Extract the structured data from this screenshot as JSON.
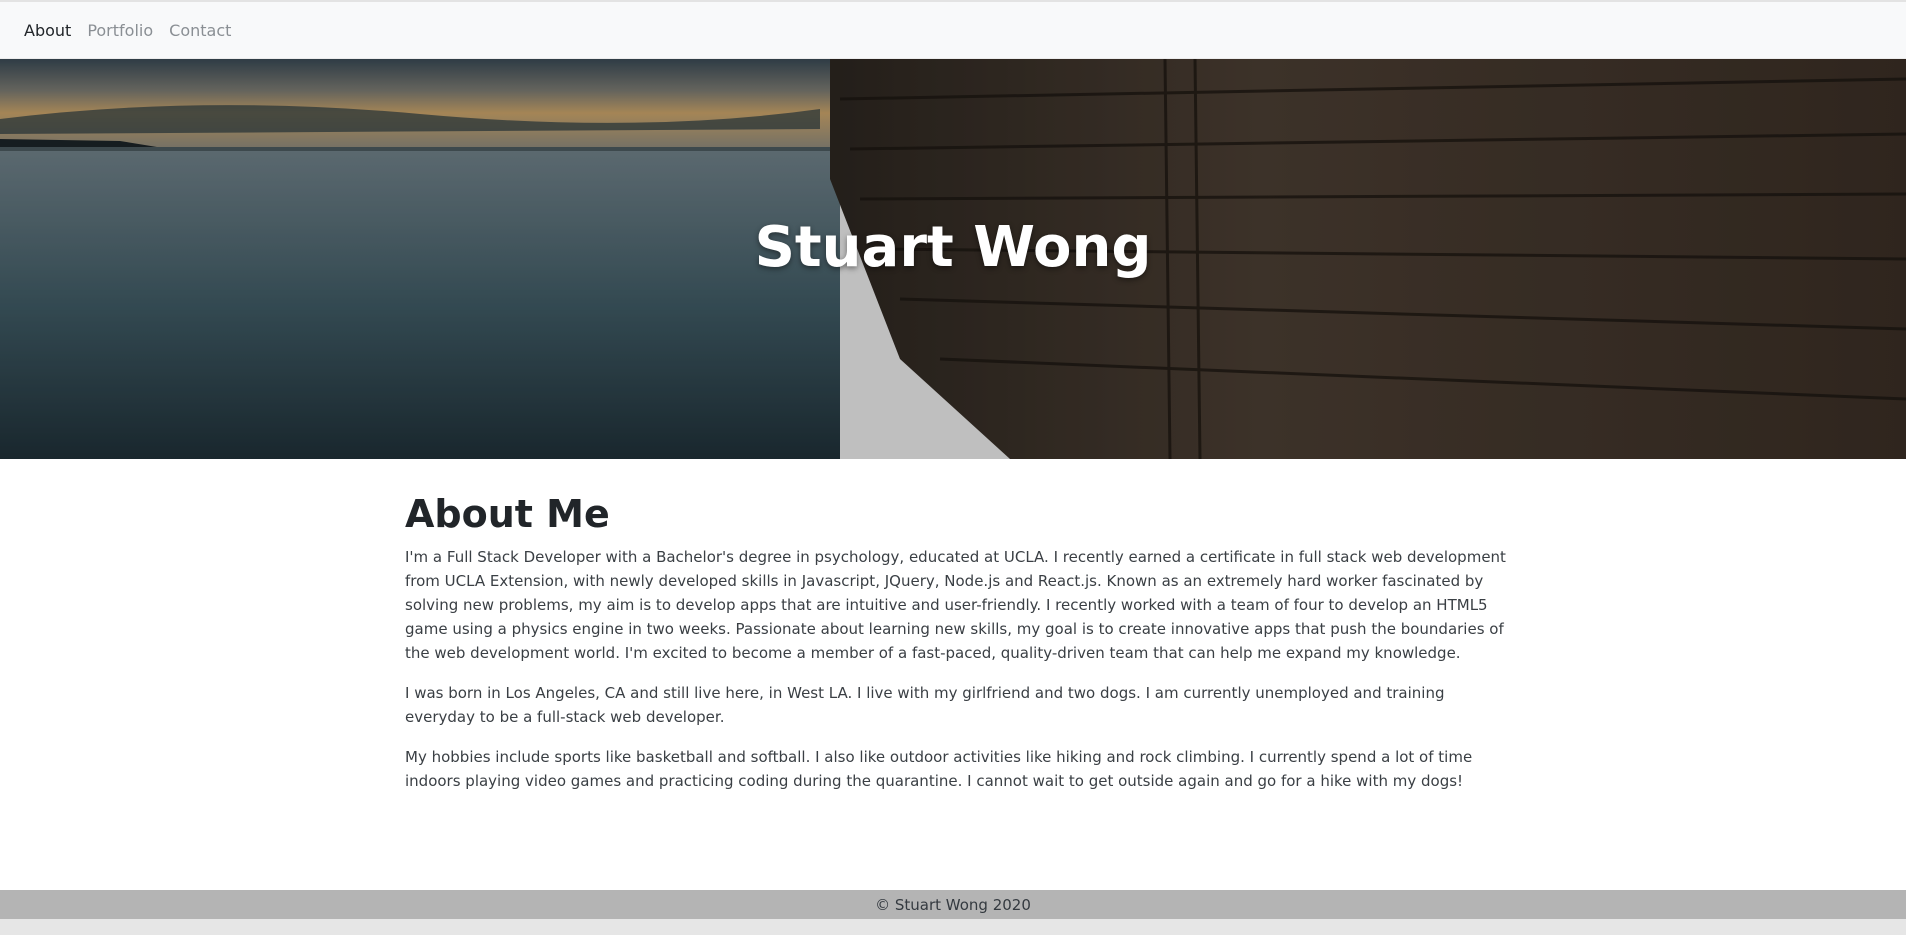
{
  "nav": {
    "links": [
      {
        "label": "About",
        "active": true
      },
      {
        "label": "Portfolio",
        "active": false
      },
      {
        "label": "Contact",
        "active": false
      }
    ]
  },
  "hero": {
    "title": "Stuart Wong"
  },
  "about": {
    "heading": "About Me",
    "paragraphs": [
      "I'm a Full Stack Developer with a Bachelor's degree in psychology, educated at UCLA. I recently earned a certificate in full stack web development from UCLA Extension, with newly developed skills in Javascript, JQuery, Node.js and React.js. Known as an extremely hard worker fascinated by solving new problems, my aim is to develop apps that are intuitive and user-friendly. I recently worked with a team of four to develop an HTML5 game using a physics engine in two weeks. Passionate about learning new skills, my goal is to create innovative apps that push the boundaries of the web development world. I'm excited to become a member of a fast-paced, quality-driven team that can help me expand my knowledge.",
      "I was born in Los Angeles, CA and still live here, in West LA. I live with my girlfriend and two dogs. I am currently unemployed and training everyday to be a full-stack web developer.",
      "My hobbies include sports like basketball and softball. I also like outdoor activities like hiking and rock climbing. I currently spend a lot of time indoors playing video games and practicing coding during the quarantine. I cannot wait to get outside again and go for a hike with my dogs!"
    ]
  },
  "footer": {
    "text": "© Stuart Wong 2020"
  },
  "colors": {
    "navbar_bg": "#f8f9fa",
    "footer_bg": "#b4b4b4",
    "text_dark": "#212529",
    "nav_muted": "#8a8f94"
  }
}
